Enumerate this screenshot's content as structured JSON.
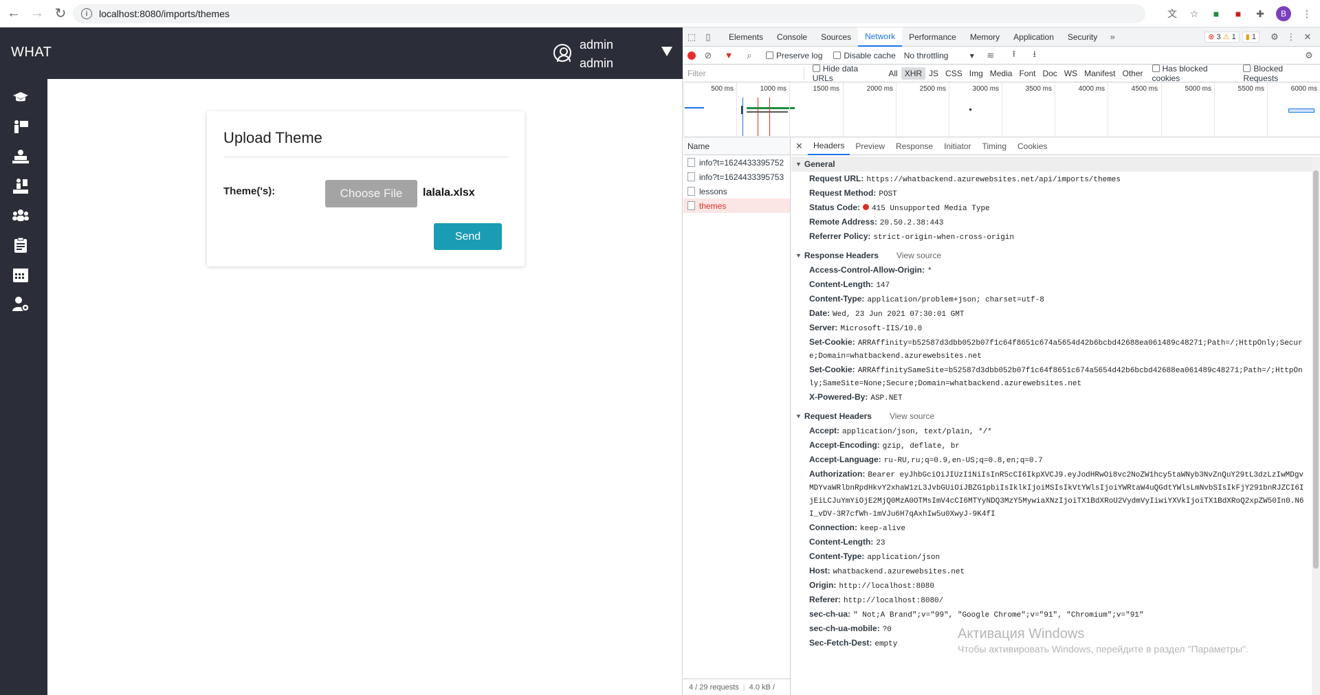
{
  "browser": {
    "url": "localhost:8080/imports/themes",
    "profile_initial": "B"
  },
  "app": {
    "brand": "WHAT",
    "user": {
      "line1": "admin",
      "line2": "admin"
    },
    "sidebar_icons": [
      "graduation-cap-icon",
      "teacher-icon",
      "students-icon",
      "mentor-icon",
      "groups-icon",
      "clipboard-icon",
      "calendar-icon",
      "user-settings-icon"
    ],
    "card": {
      "title": "Upload Theme",
      "field_label": "Theme('s):",
      "choose_label": "Choose File",
      "file_name": "lalala.xlsx",
      "send_label": "Send"
    }
  },
  "devtools": {
    "tabs": [
      "Elements",
      "Console",
      "Sources",
      "Network",
      "Performance",
      "Memory",
      "Application",
      "Security"
    ],
    "active_tab": "Network",
    "more": "»",
    "badges": {
      "errors": "3",
      "warnings": "1",
      "issues": "1"
    },
    "toolbar": {
      "preserve_log": "Preserve log",
      "disable_cache": "Disable cache",
      "throttling": "No throttling"
    },
    "filter": {
      "placeholder": "Filter",
      "hide_data_urls": "Hide data URLs",
      "types": [
        "All",
        "XHR",
        "JS",
        "CSS",
        "Img",
        "Media",
        "Font",
        "Doc",
        "WS",
        "Manifest",
        "Other"
      ],
      "active_type": "XHR",
      "has_blocked_cookies": "Has blocked cookies",
      "blocked_requests": "Blocked Requests"
    },
    "timeline_ticks": [
      "500 ms",
      "1000 ms",
      "1500 ms",
      "2000 ms",
      "2500 ms",
      "3000 ms",
      "3500 ms",
      "4000 ms",
      "4500 ms",
      "5000 ms",
      "5500 ms",
      "6000 ms"
    ],
    "request_list": {
      "header": "Name",
      "items": [
        "info?t=1624433395752",
        "info?t=1624433395753",
        "lessons",
        "themes"
      ],
      "selected": "themes",
      "footer_requests": "4 / 29 requests",
      "footer_size": "4.0 kB /"
    },
    "detail_tabs": [
      "Headers",
      "Preview",
      "Response",
      "Initiator",
      "Timing",
      "Cookies"
    ],
    "active_detail_tab": "Headers",
    "general": {
      "title": "General",
      "rows": [
        {
          "k": "Request URL:",
          "v": "https://whatbackend.azurewebsites.net/api/imports/themes"
        },
        {
          "k": "Request Method:",
          "v": "POST"
        },
        {
          "k": "Status Code:",
          "v": "415 Unsupported Media Type"
        },
        {
          "k": "Remote Address:",
          "v": "20.50.2.38:443"
        },
        {
          "k": "Referrer Policy:",
          "v": "strict-origin-when-cross-origin"
        }
      ]
    },
    "response_headers": {
      "title": "Response Headers",
      "view_source": "View source",
      "rows": [
        {
          "k": "Access-Control-Allow-Origin:",
          "v": "*"
        },
        {
          "k": "Content-Length:",
          "v": "147"
        },
        {
          "k": "Content-Type:",
          "v": "application/problem+json; charset=utf-8"
        },
        {
          "k": "Date:",
          "v": "Wed, 23 Jun 2021 07:30:01 GMT"
        },
        {
          "k": "Server:",
          "v": "Microsoft-IIS/10.0"
        },
        {
          "k": "Set-Cookie:",
          "v": "ARRAffinity=b52587d3dbb052b07f1c64f8651c674a5654d42b6bcbd42688ea061489c48271;Path=/;HttpOnly;Secure;Domain=whatbackend.azurewebsites.net"
        },
        {
          "k": "Set-Cookie:",
          "v": "ARRAffinitySameSite=b52587d3dbb052b07f1c64f8651c674a5654d42b6bcbd42688ea061489c48271;Path=/;HttpOnly;SameSite=None;Secure;Domain=whatbackend.azurewebsites.net"
        },
        {
          "k": "X-Powered-By:",
          "v": "ASP.NET"
        }
      ]
    },
    "request_headers": {
      "title": "Request Headers",
      "view_source": "View source",
      "rows": [
        {
          "k": "Accept:",
          "v": "application/json, text/plain, */*"
        },
        {
          "k": "Accept-Encoding:",
          "v": "gzip, deflate, br"
        },
        {
          "k": "Accept-Language:",
          "v": "ru-RU,ru;q=0.9,en-US;q=0.8,en;q=0.7"
        },
        {
          "k": "Authorization:",
          "v": "Bearer eyJhbGciOiJIUzI1NiIsInR5cCI6IkpXVCJ9.eyJodHRwOi8vc2NoZW1hcy5taWNyb3NvZnQuY29tL3dzLzIwMDgvMDYvaWRlbnRpdHkvY2xhaW1zL3JvbGUiOiJBZG1pbiIsIklkIjoiMSIsIkVtYWlsIjoiYWRtaW4uQGdtYWlsLmNvbSIsIkFjY291bnRJZCI6IjEiLCJuYmYiOjE2MjQ0MzA0OTMsImV4cCI6MTYyNDQ3MzY5MywiaXNzIjoiTX1BdXRoU2VydmVyIiwiYXVkIjoiTX1BdXRoQ2xpZW50In0.N6I_vDV-3R7cfWh-1mVJu6H7qAxhIw5u0XwyJ-9K4fI"
        },
        {
          "k": "Connection:",
          "v": "keep-alive"
        },
        {
          "k": "Content-Length:",
          "v": "23"
        },
        {
          "k": "Content-Type:",
          "v": "application/json"
        },
        {
          "k": "Host:",
          "v": "whatbackend.azurewebsites.net"
        },
        {
          "k": "Origin:",
          "v": "http://localhost:8080"
        },
        {
          "k": "Referer:",
          "v": "http://localhost:8080/"
        },
        {
          "k": "sec-ch-ua:",
          "v": "\" Not;A Brand\";v=\"99\", \"Google Chrome\";v=\"91\", \"Chromium\";v=\"91\""
        },
        {
          "k": "sec-ch-ua-mobile:",
          "v": "?0"
        },
        {
          "k": "Sec-Fetch-Dest:",
          "v": "empty"
        }
      ]
    }
  },
  "watermark": {
    "line1": "Активация Windows",
    "line2": "Чтобы активировать Windows, перейдите в раздел \"Параметры\"."
  }
}
